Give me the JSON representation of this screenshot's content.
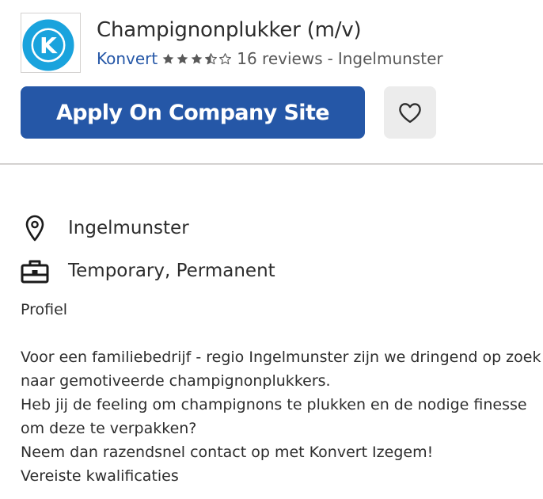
{
  "job": {
    "title": "Champignonplukker (m/v)",
    "company": "Konvert",
    "rating": 3.5,
    "rating_max": 5,
    "reviews": "16 reviews",
    "separator": "-",
    "location": "Ingelmunster",
    "logo_letter": "K"
  },
  "actions": {
    "apply_label": "Apply On Company Site",
    "save_icon": "heart-icon"
  },
  "details": {
    "location_icon": "map-pin-icon",
    "location": "Ingelmunster",
    "job_type_icon": "briefcase-icon",
    "job_type": "Temporary, Permanent"
  },
  "description": {
    "heading": "Profiel",
    "line1": "Voor een familiebedrijf - regio Ingelmunster zijn we dringend op zoek",
    "line2": "naar gemotiveerde champignonplukkers.",
    "line3": "Heb jij de feeling om champignons te plukken en de nodige finesse",
    "line4": "om deze te verpakken?",
    "line5": "Neem dan razendsnel contact op met Konvert Izegem!",
    "line6": "Vereiste kwalificaties"
  },
  "colors": {
    "brand_blue": "#2557a7",
    "logo_cyan": "#1aa3dd",
    "star_gray": "#595959",
    "save_bg": "#ececec"
  }
}
